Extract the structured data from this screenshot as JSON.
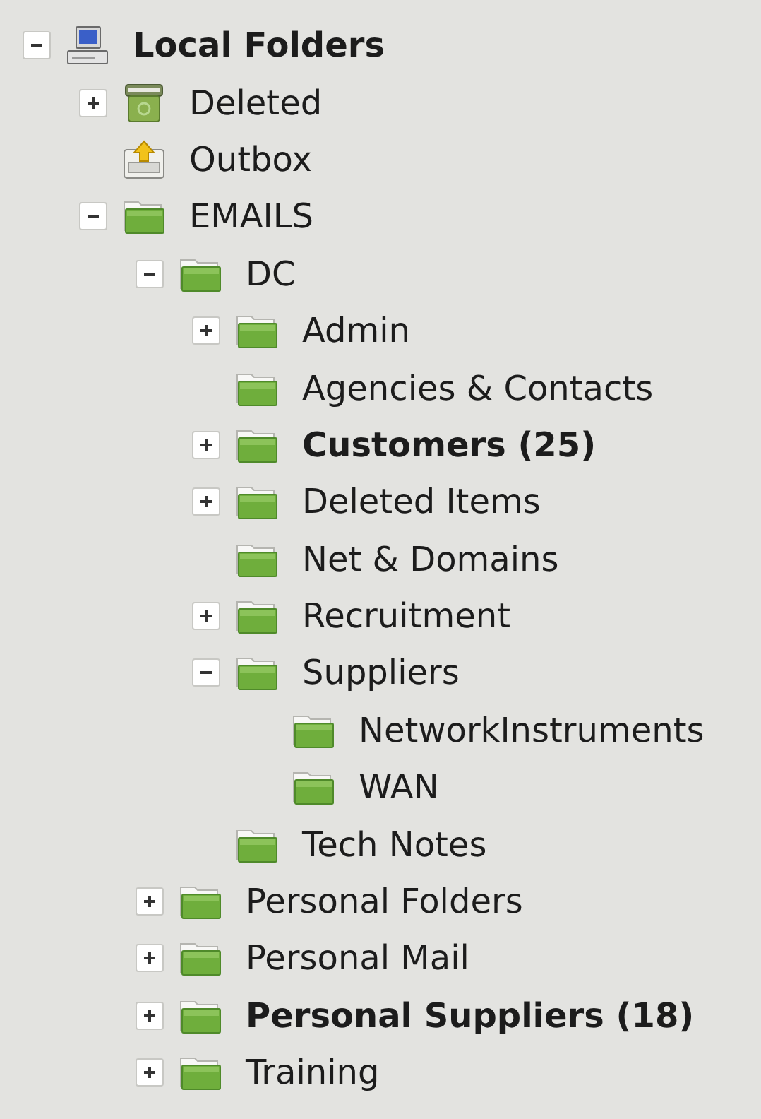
{
  "tree": [
    {
      "label": "Local Folders",
      "kind": "computer",
      "unread": true,
      "expanded": true,
      "children": [
        {
          "label": "Deleted",
          "kind": "trash",
          "unread": false,
          "expanded": false
        },
        {
          "label": "Outbox",
          "kind": "outbox",
          "unread": false
        },
        {
          "label": "EMAILS",
          "kind": "folder",
          "unread": false,
          "expanded": true,
          "children": [
            {
              "label": "DC",
              "kind": "folder",
              "unread": false,
              "expanded": true,
              "children": [
                {
                  "label": "Admin",
                  "kind": "folder",
                  "unread": false,
                  "expanded": false
                },
                {
                  "label": "Agencies & Contacts",
                  "kind": "folder",
                  "unread": false
                },
                {
                  "label": "Customers (25)",
                  "kind": "folder",
                  "unread": true,
                  "expanded": false
                },
                {
                  "label": "Deleted Items",
                  "kind": "folder",
                  "unread": false,
                  "expanded": false
                },
                {
                  "label": "Net & Domains",
                  "kind": "folder",
                  "unread": false
                },
                {
                  "label": "Recruitment",
                  "kind": "folder",
                  "unread": false,
                  "expanded": false
                },
                {
                  "label": "Suppliers",
                  "kind": "folder",
                  "unread": false,
                  "expanded": true,
                  "children": [
                    {
                      "label": "NetworkInstruments",
                      "kind": "folder",
                      "unread": false
                    },
                    {
                      "label": "WAN",
                      "kind": "folder",
                      "unread": false
                    }
                  ]
                },
                {
                  "label": "Tech Notes",
                  "kind": "folder",
                  "unread": false
                }
              ]
            },
            {
              "label": "Personal Folders",
              "kind": "folder",
              "unread": false,
              "expanded": false
            },
            {
              "label": "Personal Mail",
              "kind": "folder",
              "unread": false,
              "expanded": false
            },
            {
              "label": "Personal Suppliers (18)",
              "kind": "folder",
              "unread": true,
              "expanded": false
            },
            {
              "label": "Training",
              "kind": "folder",
              "unread": false,
              "expanded": false
            }
          ]
        }
      ]
    }
  ]
}
